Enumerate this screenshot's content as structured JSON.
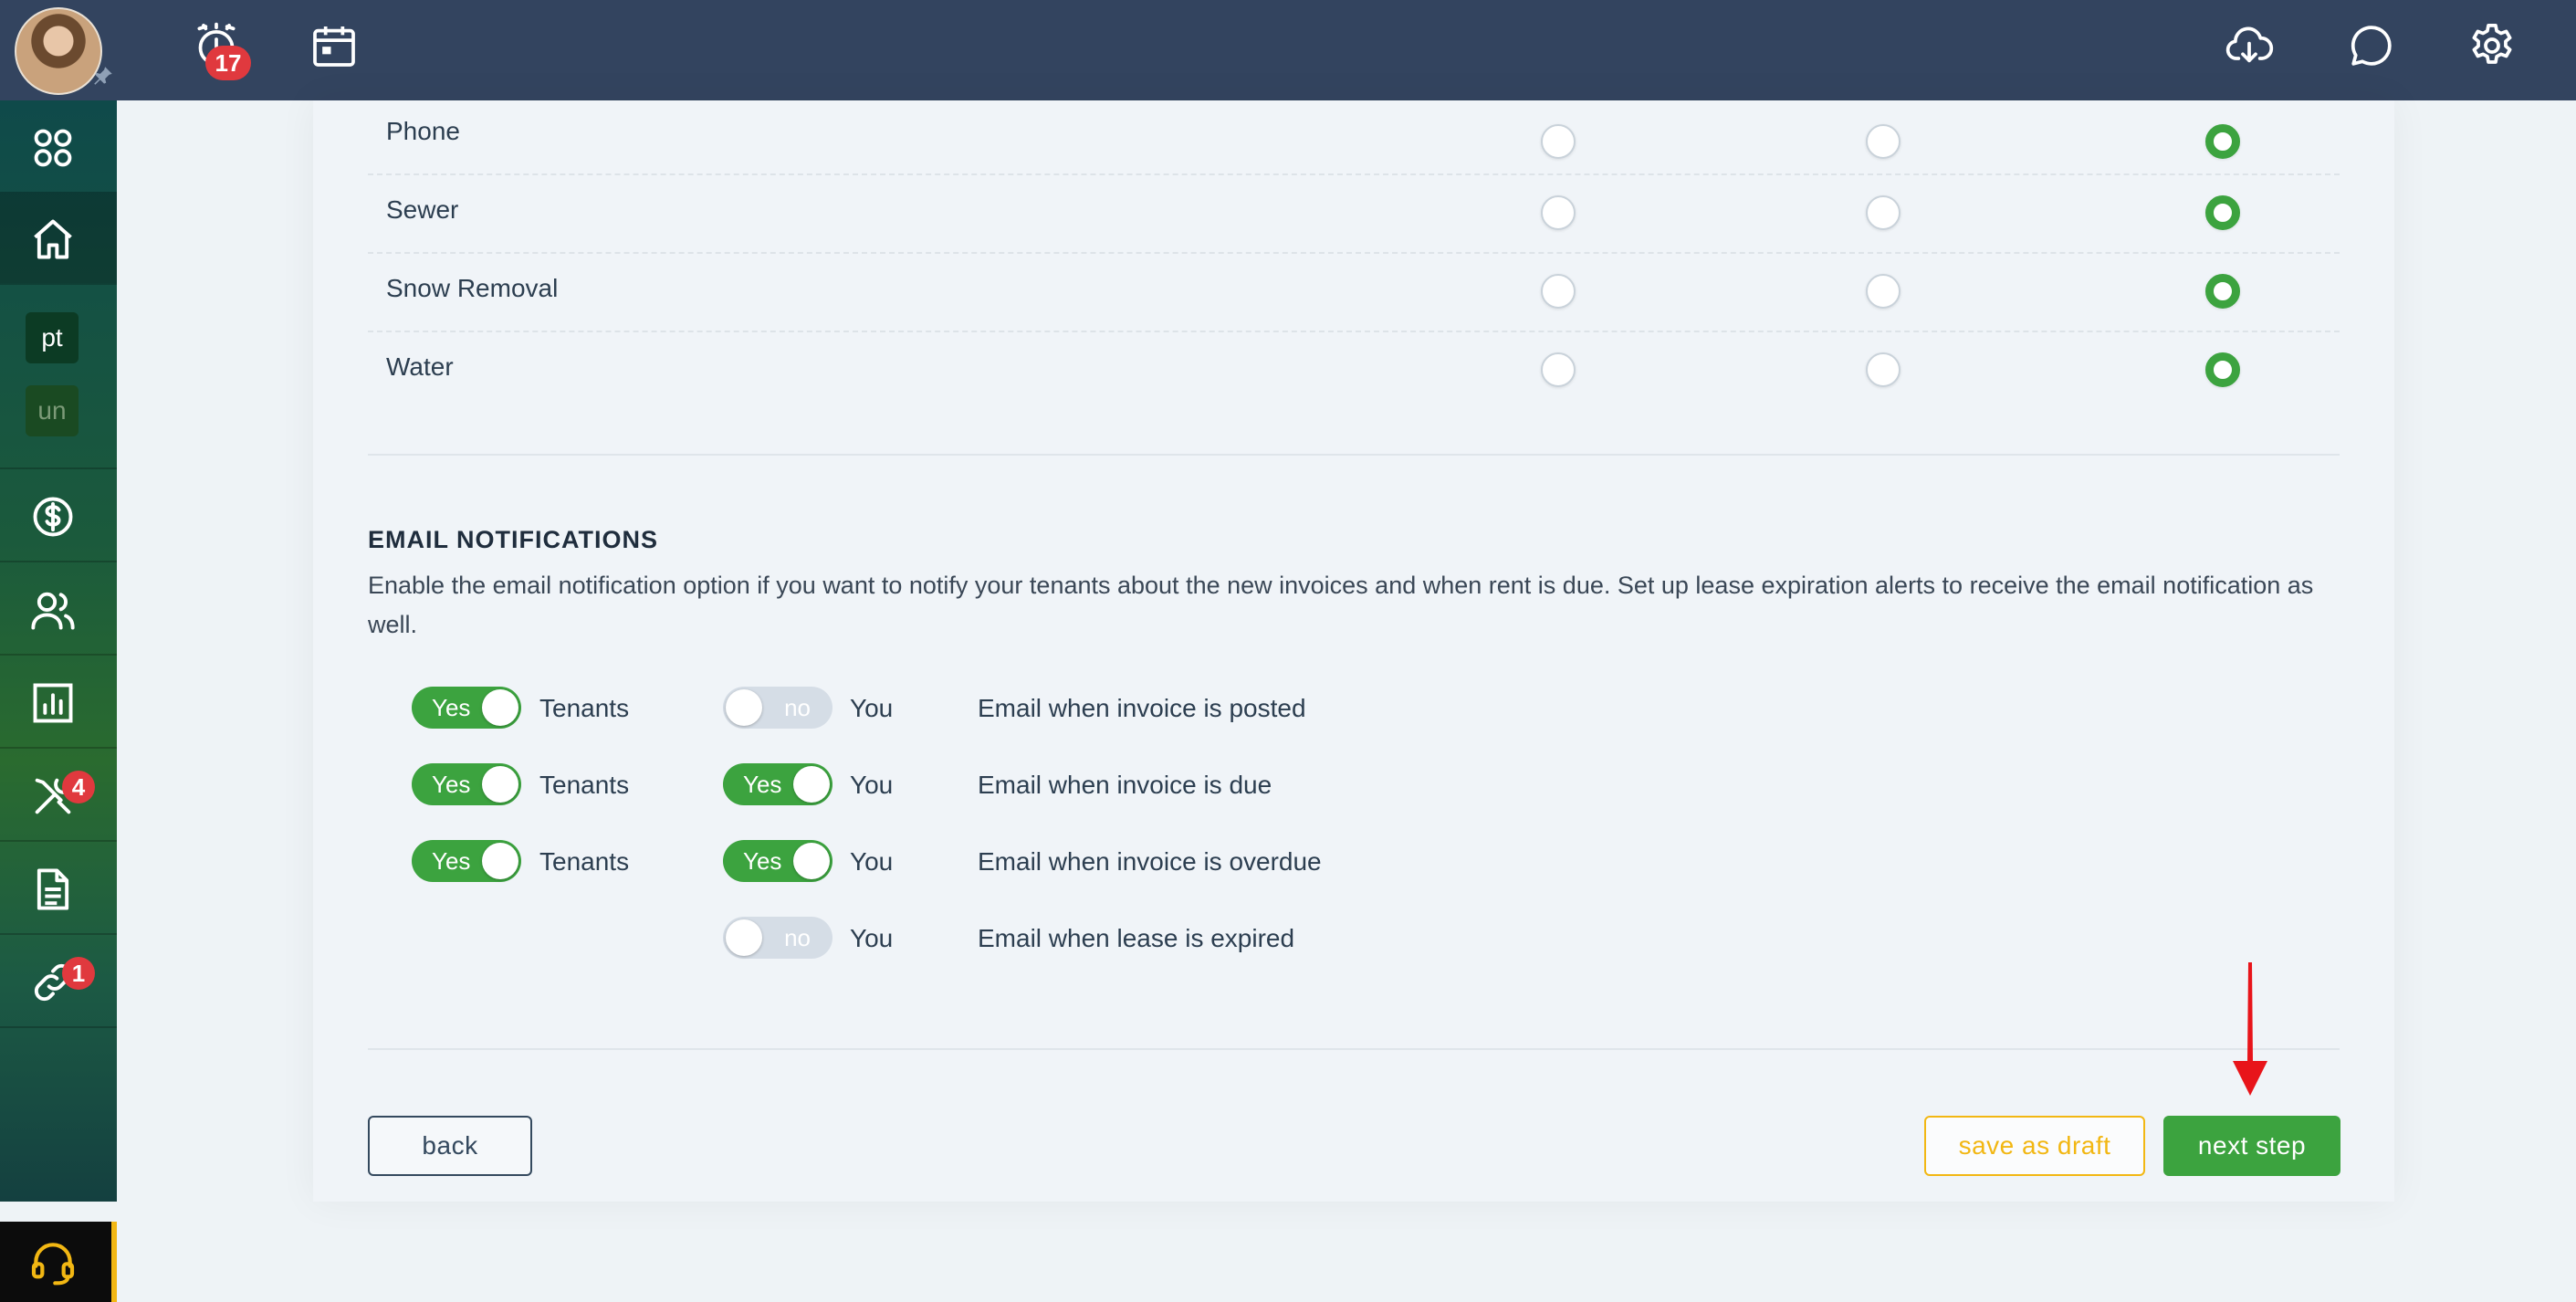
{
  "topbar": {
    "alarm_badge": "17"
  },
  "sidebar": {
    "tags": [
      "pt",
      "un"
    ],
    "maintenance_badge": "4",
    "links_badge": "1"
  },
  "utilities": [
    {
      "label": "Phone",
      "selected": 3
    },
    {
      "label": "Sewer",
      "selected": 3
    },
    {
      "label": "Snow Removal",
      "selected": 3
    },
    {
      "label": "Water",
      "selected": 3
    }
  ],
  "email_notifications": {
    "title": "EMAIL NOTIFICATIONS",
    "description": "Enable the email notification option if you want to notify your tenants about the new invoices and when rent is due. Set up lease expiration alerts to receive the email notification as well.",
    "yes_label": "Yes",
    "no_label": "no",
    "rows": [
      {
        "tenants": "Tenants",
        "tenants_on": true,
        "you": "You",
        "you_on": false,
        "text": "Email when invoice is posted"
      },
      {
        "tenants": "Tenants",
        "tenants_on": true,
        "you": "You",
        "you_on": true,
        "text": "Email when invoice is due"
      },
      {
        "tenants": "Tenants",
        "tenants_on": true,
        "you": "You",
        "you_on": true,
        "text": "Email when invoice is overdue"
      },
      {
        "you": "You",
        "you_on": false,
        "text": "Email when lease is expired"
      }
    ]
  },
  "footer": {
    "back": "back",
    "save_draft": "save as draft",
    "next_step": "next step"
  },
  "colors": {
    "topbar": "#33445f",
    "accent_green": "#3ca33f",
    "draft_yellow": "#f2b713",
    "badge_red": "#e0393e",
    "annotation_arrow": "#e8141a"
  }
}
